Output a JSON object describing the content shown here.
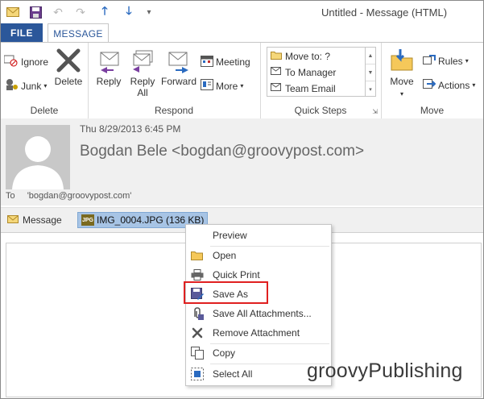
{
  "window": {
    "title": "Untitled - Message (HTML)"
  },
  "tabs": {
    "file": "FILE",
    "message": "MESSAGE"
  },
  "ribbon": {
    "delete_group": {
      "label": "Delete",
      "ignore": "Ignore",
      "junk": "Junk",
      "delete": "Delete"
    },
    "respond_group": {
      "label": "Respond",
      "reply": "Reply",
      "reply_all_line1": "Reply",
      "reply_all_line2": "All",
      "forward": "Forward",
      "meeting": "Meeting",
      "more": "More"
    },
    "quick_steps": {
      "label": "Quick Steps",
      "items": [
        "Move to: ?",
        "To Manager",
        "Team Email"
      ]
    },
    "move_group": {
      "label": "Move",
      "move": "Move",
      "rules": "Rules",
      "actions": "Actions"
    }
  },
  "message": {
    "date": "Thu 8/29/2013 6:45 PM",
    "sender": "Bogdan Bele <bogdan@groovypost.com>",
    "to_label": "To",
    "to_value": "'bogdan@groovypost.com'",
    "message_tab": "Message",
    "attachment": "IMG_0004.JPG (136 KB)",
    "attachment_icon_text": "JPG"
  },
  "context_menu": {
    "preview": "Preview",
    "open": "Open",
    "quick_print": "Quick Print",
    "save_as": "Save As",
    "save_all": "Save All Attachments...",
    "remove": "Remove Attachment",
    "copy": "Copy",
    "select_all": "Select All"
  },
  "watermark": "groovyPublishing",
  "colors": {
    "accent": "#2b579a",
    "highlight_border": "#e02020",
    "attachment_bg": "#a7c4e5"
  }
}
